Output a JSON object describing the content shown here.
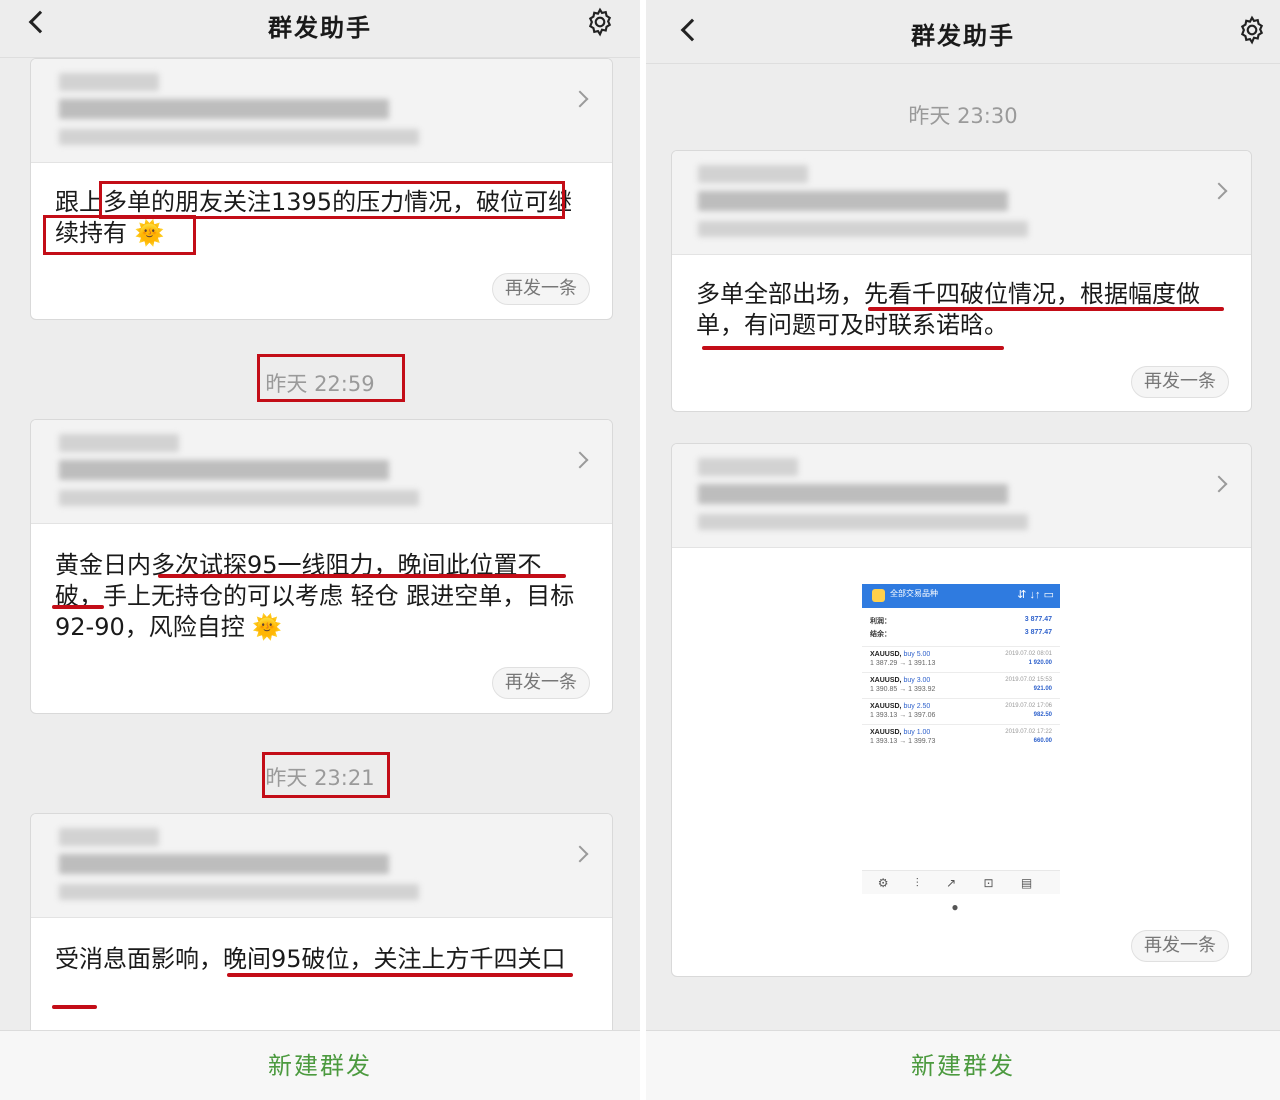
{
  "left": {
    "header": {
      "title": "群发助手"
    },
    "cards": [
      {
        "message": "跟上多单的朋友关注1395的压力情况，破位可继续持有 🌞",
        "resend": "再发一条"
      },
      {
        "time": "昨天 22:59",
        "message": "黄金日内多次试探95一线阻力，晚间此位置不破，手上无持仓的可以考虑 轻仓 跟进空单，目标92-90，风险自控 🌞",
        "resend": "再发一条"
      },
      {
        "time": "昨天 23:21",
        "message": "受消息面影响，晚间95破位，关注上方千四关口"
      }
    ],
    "footer": "新建群发"
  },
  "right": {
    "header": {
      "title": "群发助手"
    },
    "cards": [
      {
        "time": "昨天 23:30",
        "message": "多单全部出场，先看千四破位情况，根据幅度做单，有问题可及时联系诺晗。",
        "resend": "再发一条"
      },
      {
        "resend": "再发一条",
        "screenshot": {
          "header_label": "全部交易品种",
          "header_icons": "⇵ ↓↑ ▭",
          "profit_label": "利润：",
          "profit_value": "3 877.47",
          "equity_label": "结余：",
          "equity_value": "3 877.47",
          "trades": [
            {
              "symbol": "XAUUSD,",
              "side": "buy 5.00",
              "prices": "1 387.29 → 1 391.13",
              "time": "2019.07.02 08:01",
              "profit": "1 920.00"
            },
            {
              "symbol": "XAUUSD,",
              "side": "buy 3.00",
              "prices": "1 390.85 → 1 393.92",
              "time": "2019.07.02 15:53",
              "profit": "921.00"
            },
            {
              "symbol": "XAUUSD,",
              "side": "buy 2.50",
              "prices": "1 393.13 → 1 397.06",
              "time": "2019.07.02 17:06",
              "profit": "982.50"
            },
            {
              "symbol": "XAUUSD,",
              "side": "buy 1.00",
              "prices": "1 393.13 → 1 399.73",
              "time": "2019.07.02 17:22",
              "profit": "660.00"
            }
          ],
          "bottom_icons": "⚙ ⫶ ↗ ⊡ ▤ ●"
        }
      }
    ],
    "footer": "新建群发"
  }
}
